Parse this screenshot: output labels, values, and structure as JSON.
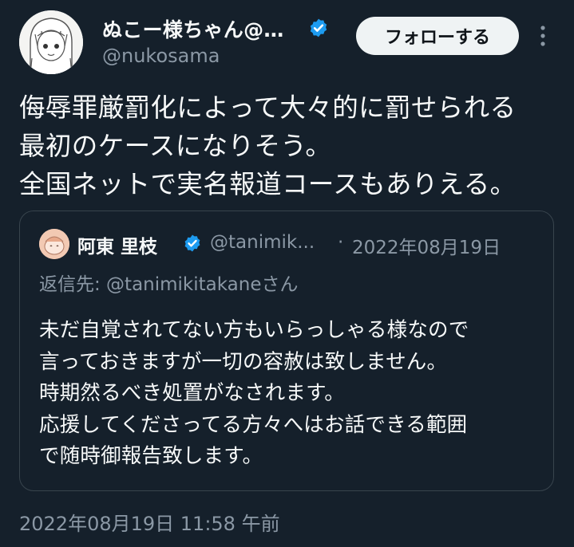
{
  "author": {
    "display_name": "ぬこー様ちゃん@…",
    "handle": "@nukosama",
    "verified": true
  },
  "follow_button": {
    "label": "フォローする"
  },
  "tweet": {
    "text": "侮辱罪厳罰化によって大々的に罰せられる\n最初のケースになりそう。\n全国ネットで実名報道コースもありえる。",
    "timestamp": "2022年08月19日 11:58 午前"
  },
  "quote": {
    "display_name": "阿東 里枝",
    "handle": "@tanimik...",
    "separator": "·",
    "date": "2022年08月19日",
    "reply_to": "返信先: @tanimikitakaneさん",
    "text": "未だ自覚されてない方もいらっしゃる様なので\n言っておきますが一切の容赦は致しません。\n時期然るべき処置がなされます。\n応援してくださってる方々へはお話できる範囲\nで随時御報告致します。"
  },
  "colors": {
    "background": "#15202b",
    "verified_blue": "#1d9bf0",
    "secondary_text": "#8b98a5",
    "border": "#38444d"
  },
  "icons": [
    "avatar-icon",
    "verified-badge-icon",
    "more-options-icon"
  ]
}
